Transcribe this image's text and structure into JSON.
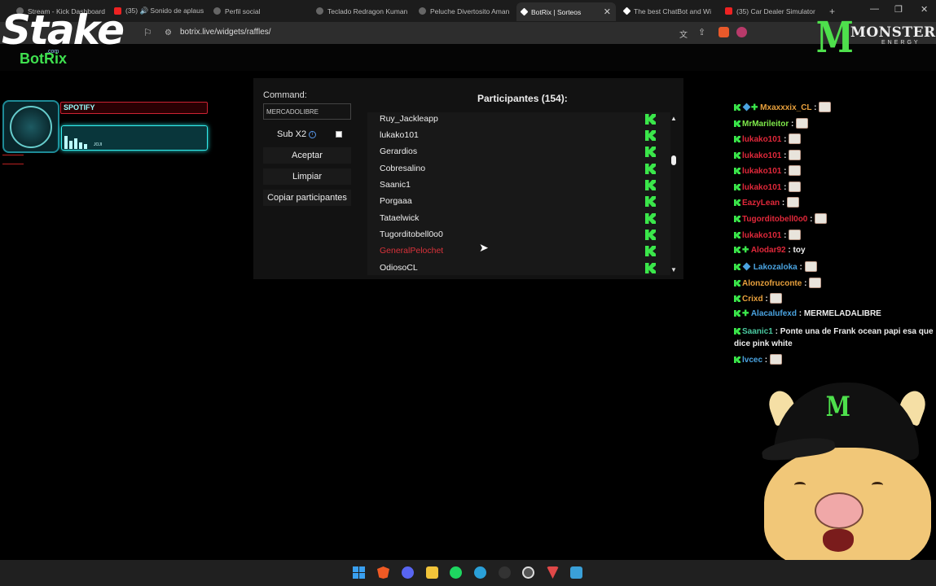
{
  "browser": {
    "tabs": [
      {
        "label": "Stream - Kick Dashboard",
        "icon": "kick-icon"
      },
      {
        "label": "(35) 🔊 Sonido de aplaus",
        "icon": "youtube-icon"
      },
      {
        "label": "Perfil social",
        "icon": "globe-icon"
      },
      {
        "label": "Teclado Redragon Kuman",
        "icon": "globe-icon"
      },
      {
        "label": "Peluche Divertosito Aman",
        "icon": "globe-icon"
      },
      {
        "label": "BotRix | Sorteos",
        "icon": "botrix-icon"
      },
      {
        "label": "The best ChatBot and Wi",
        "icon": "botrix-icon"
      },
      {
        "label": "(35) Car Dealer Simulator",
        "icon": "youtube-icon"
      }
    ],
    "new_tab": "+",
    "url": "botrix.live/widgets/raffles/"
  },
  "overlay": {
    "stake_logo": "Stake",
    "botrix_logo": "BotRix",
    "botrix_sub": ".com",
    "monster_mark": "M",
    "monster_word": "MONSTER",
    "energy_word": "ENERGY",
    "spotify_title": "SPOTIFY",
    "spotify_artist": "JOJI"
  },
  "raffle": {
    "command_label": "Command:",
    "command_value": "MERCADOLIBRE",
    "sub_label": "Sub X2",
    "sub_checked": false,
    "accept_label": "Aceptar",
    "clear_label": "Limpiar",
    "copy_label": "Copiar participantes",
    "participants_title": "Participantes (154):",
    "participants": [
      {
        "name": "Ruy_Jackleapp",
        "highlight": false
      },
      {
        "name": "lukako101",
        "highlight": false
      },
      {
        "name": "Gerardios",
        "highlight": false
      },
      {
        "name": "Cobresalino",
        "highlight": false
      },
      {
        "name": "Saanic1",
        "highlight": false
      },
      {
        "name": "Porgaaa",
        "highlight": false
      },
      {
        "name": "Tataelwick",
        "highlight": false
      },
      {
        "name": "Tugorditobell0o0",
        "highlight": false
      },
      {
        "name": "GeneralPelochet",
        "highlight": true
      },
      {
        "name": "OdiosoCL",
        "highlight": false
      }
    ]
  },
  "chat": [
    {
      "user": "Mxaxxxix_CL",
      "color": "#e8a03c",
      "msg": "",
      "emote": true
    },
    {
      "user": "MrMarileitor",
      "color": "#7ee84a",
      "msg": "",
      "emote": true
    },
    {
      "user": "lukako101",
      "color": "#e0283a",
      "msg": "",
      "emote": true
    },
    {
      "user": "lukako101",
      "color": "#e0283a",
      "msg": "",
      "emote": true
    },
    {
      "user": "lukako101",
      "color": "#e0283a",
      "msg": "",
      "emote": true
    },
    {
      "user": "lukako101",
      "color": "#e0283a",
      "msg": "",
      "emote": true
    },
    {
      "user": "EazyLean",
      "color": "#e0283a",
      "msg": "",
      "emote": true
    },
    {
      "user": "Tugorditobell0o0",
      "color": "#e0283a",
      "msg": "",
      "emote": true
    },
    {
      "user": "lukako101",
      "color": "#e0283a",
      "msg": "",
      "emote": true
    },
    {
      "user": "Alodar92",
      "color": "#e0283a",
      "msg": "toy",
      "emote": false
    },
    {
      "user": "Lakozaloka",
      "color": "#4aa3e0",
      "msg": "",
      "emote": true
    },
    {
      "user": "Alonzofruconte",
      "color": "#e8a03c",
      "msg": "",
      "emote": true
    },
    {
      "user": "Crixd",
      "color": "#e8a03c",
      "msg": "",
      "emote": true
    },
    {
      "user": "Alacalufexd",
      "color": "#4aa3e0",
      "msg": "MERMELADALIBRE",
      "emote": false
    }
  ],
  "chat_long": {
    "user": "Saanic1",
    "color": "#4ac8a0",
    "msg": "Ponte una de Frank ocean papi esa que dice pink white"
  },
  "chat_last": {
    "user": "lvcec",
    "color": "#4aa3e0"
  }
}
